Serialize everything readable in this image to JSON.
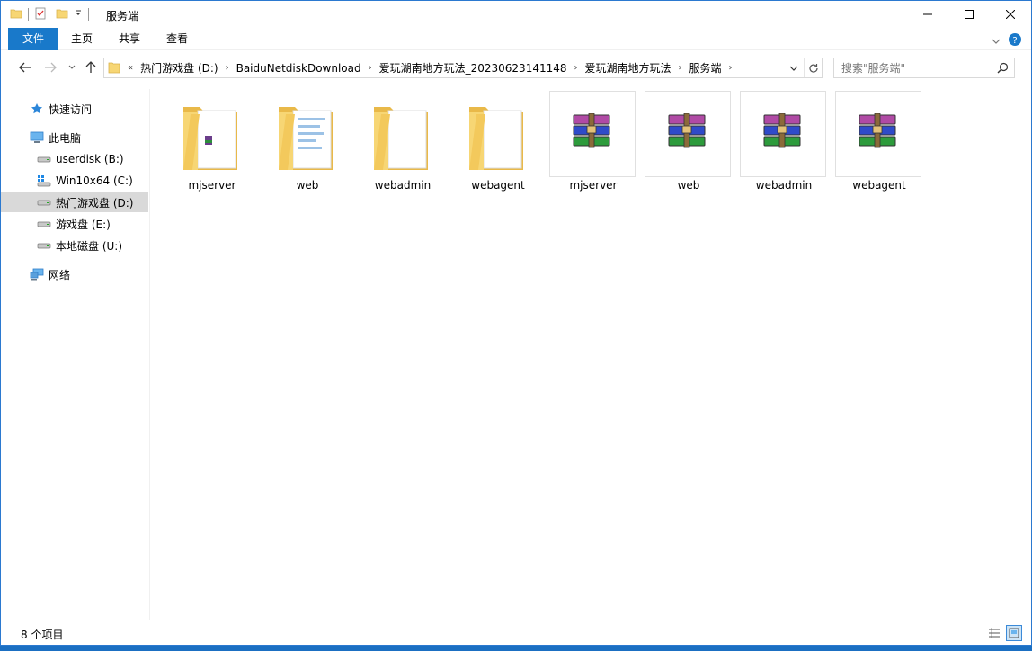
{
  "window": {
    "title": "服务端"
  },
  "ribbon": {
    "tabs": [
      "文件",
      "主页",
      "共享",
      "查看"
    ]
  },
  "address": {
    "crumbs": [
      "热门游戏盘 (D:)",
      "BaiduNetdiskDownload",
      "爱玩湖南地方玩法_20230623141148",
      "爱玩湖南地方玩法",
      "服务端"
    ]
  },
  "search": {
    "placeholder": "搜索\"服务端\""
  },
  "sidebar": {
    "items": [
      {
        "label": "快速访问",
        "icon": "star-icon"
      },
      {
        "label": "此电脑",
        "icon": "computer-icon"
      },
      {
        "label": "userdisk (B:)",
        "icon": "drive-icon"
      },
      {
        "label": "Win10x64 (C:)",
        "icon": "windows-drive-icon"
      },
      {
        "label": "热门游戏盘 (D:)",
        "icon": "drive-icon"
      },
      {
        "label": "游戏盘 (E:)",
        "icon": "drive-icon"
      },
      {
        "label": "本地磁盘 (U:)",
        "icon": "drive-icon"
      },
      {
        "label": "网络",
        "icon": "network-icon"
      }
    ]
  },
  "files": [
    {
      "name": "mjserver",
      "type": "folder"
    },
    {
      "name": "web",
      "type": "folder"
    },
    {
      "name": "webadmin",
      "type": "folder"
    },
    {
      "name": "webagent",
      "type": "folder"
    },
    {
      "name": "mjserver",
      "type": "rar"
    },
    {
      "name": "web",
      "type": "rar"
    },
    {
      "name": "webadmin",
      "type": "rar"
    },
    {
      "name": "webagent",
      "type": "rar"
    }
  ],
  "status": {
    "count": "8 个项目"
  },
  "colors": {
    "accent": "#1979ca",
    "folder": "#f7d674",
    "selected": "#d9d9d9"
  }
}
